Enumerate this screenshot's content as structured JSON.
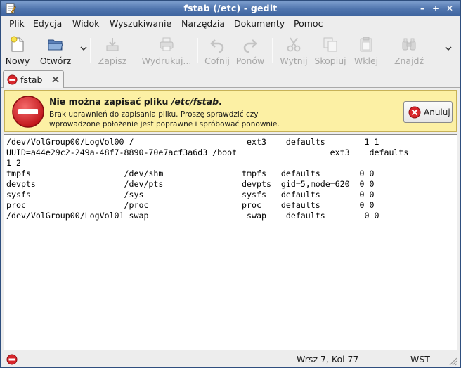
{
  "window": {
    "title": "fstab (/etc) - gedit"
  },
  "menu": {
    "items": [
      {
        "label": "Plik"
      },
      {
        "label": "Edycja"
      },
      {
        "label": "Widok"
      },
      {
        "label": "Wyszukiwanie"
      },
      {
        "label": "Narzędzia"
      },
      {
        "label": "Dokumenty"
      },
      {
        "label": "Pomoc"
      }
    ]
  },
  "toolbar": {
    "new": "Nowy",
    "open": "Otwórz",
    "save": "Zapisz",
    "print": "Wydrukuj...",
    "undo": "Cofnij",
    "redo": "Ponów",
    "cut": "Wytnij",
    "copy": "Skopiuj",
    "paste": "Wklej",
    "find": "Znajdź"
  },
  "tab": {
    "label": "fstab"
  },
  "infobar": {
    "heading_prefix": "Nie można zapisać pliku ",
    "heading_path": "/etc/fstab",
    "heading_suffix": ".",
    "message_line1": "Brak uprawnień do zapisania pliku. Proszę sprawdzić czy",
    "message_line2": "wprowadzone położenie jest poprawne i spróbować ponownie.",
    "cancel_label": "Anuluj"
  },
  "editor": {
    "lines": [
      "/dev/VolGroup00/LogVol00 /                       ext3    defaults        1 1",
      "UUID=a44e29c2-249a-48f7-8890-70e7acf3a6d3 /boot                   ext3    defaults",
      "1 2",
      "tmpfs                   /dev/shm                tmpfs   defaults        0 0",
      "devpts                  /dev/pts                devpts  gid=5,mode=620  0 0",
      "sysfs                   /sys                    sysfs   defaults        0 0",
      "proc                    /proc                   proc    defaults        0 0",
      "/dev/VolGroup00/LogVol01 swap                    swap    defaults        0 0"
    ]
  },
  "statusbar": {
    "position": "Wrsz 7, Kol 77",
    "mode": "WST"
  },
  "colors": {
    "titlebar": "#4f74ad",
    "infobar_bg": "#fcf0a4",
    "error_red": "#d32f2f"
  }
}
